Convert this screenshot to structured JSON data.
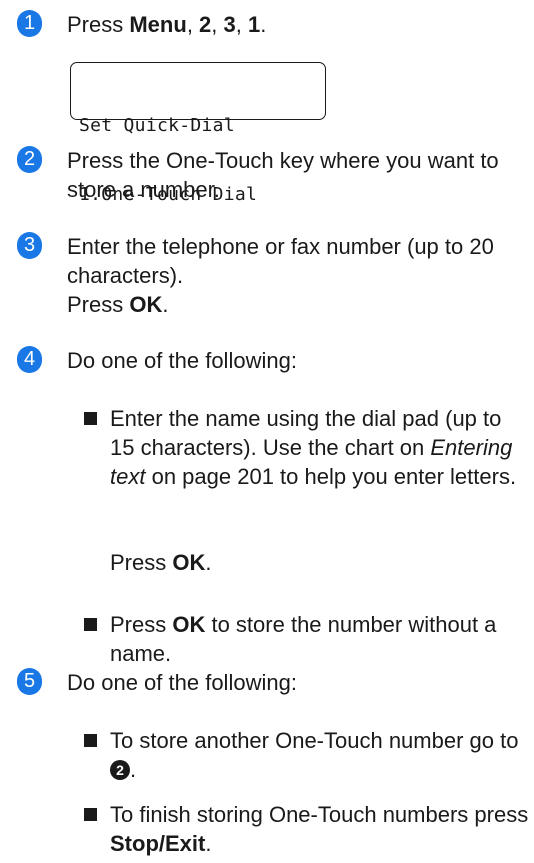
{
  "steps": [
    {
      "number": "1",
      "press": "Press ",
      "menu": "Menu",
      "sep1": ", ",
      "k2": "2",
      "sep2": ", ",
      "k3": "3",
      "sep3": ", ",
      "k1": "1",
      "end": "."
    },
    {
      "number": "2",
      "text": "Press the One-Touch key where you want to store a number."
    },
    {
      "number": "3",
      "text": "Enter the telephone or fax number (up to 20 characters).",
      "press": "Press ",
      "ok": "OK",
      "end": "."
    },
    {
      "number": "4",
      "text": "Do one of the following:"
    },
    {
      "number": "5",
      "text": "Do one of the following:"
    }
  ],
  "lcd": {
    "line1": "Set Quick-Dial",
    "line2": "1.One-Touch Dial"
  },
  "step4_bullets": {
    "b1_a": "Enter the name using the dial pad (up to 15 characters). Use the chart on ",
    "b1_italic": "Entering text",
    "b1_b": " on page 201 to help you enter letters.",
    "b1_press": "Press ",
    "b1_ok": "OK",
    "b1_end": ".",
    "b2_press": "Press ",
    "b2_ok": "OK",
    "b2_rest": " to store the number without a name."
  },
  "step5_bullets": {
    "b1_text": "To store another One-Touch number go to ",
    "b1_ref": "2",
    "b1_end": ".",
    "b2_text": "To finish storing One-Touch numbers press ",
    "b2_bold": "Stop/Exit",
    "b2_end": "."
  }
}
